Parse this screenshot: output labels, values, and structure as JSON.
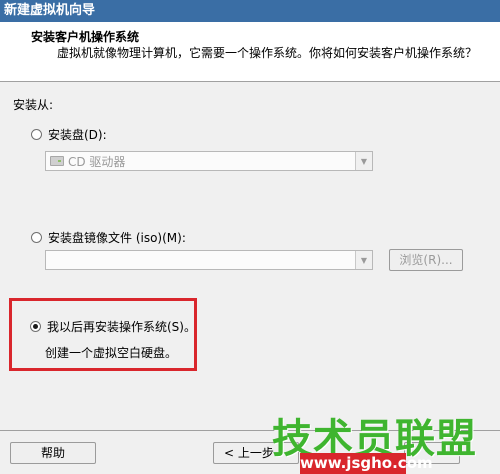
{
  "window": {
    "title": "新建虚拟机向导"
  },
  "header": {
    "title": "安装客户机操作系统",
    "description": "虚拟机就像物理计算机，它需要一个操作系统。你将如何安装客户机操作系统？"
  },
  "install_from": {
    "label": "安装从:",
    "options": [
      {
        "label": "安装盘(D):",
        "checked": false
      },
      {
        "label": "安装盘镜像文件 (iso)(M):",
        "checked": false
      },
      {
        "label": "我以后再安装操作系统(S)。",
        "checked": true
      }
    ],
    "disc_combo_value": "CD 驱动器",
    "iso_combo_value": "",
    "browse_label": "浏览(R)...",
    "later_note": "创建一个虚拟空白硬盘。"
  },
  "footer": {
    "help_label": "帮助",
    "back_label": "< 上一步"
  },
  "watermark": {
    "text": "技术员联盟",
    "url": "www.jsgho.com"
  },
  "colors": {
    "highlight_box": "#d9262c",
    "watermark_green": "#3fb52f"
  }
}
